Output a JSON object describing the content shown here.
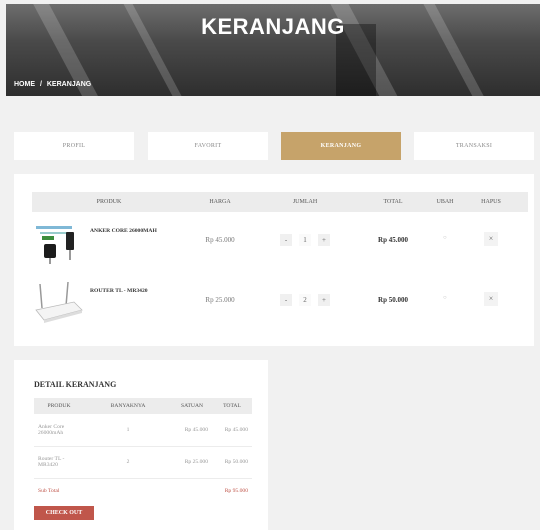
{
  "header": {
    "title": "KERANJANG",
    "breadcrumb": [
      "HOME",
      "/",
      "KERANJANG"
    ]
  },
  "tabs": [
    {
      "label": "PROFIL",
      "active": false
    },
    {
      "label": "FAVORIT",
      "active": false
    },
    {
      "label": "KERANJANG",
      "active": true
    },
    {
      "label": "TRANSAKSI",
      "active": false
    }
  ],
  "cart": {
    "columns": [
      "PRODUK",
      "HARGA",
      "JUMLAH",
      "TOTAL",
      "UBAH",
      "HAPUS"
    ],
    "items": [
      {
        "name": "ANKER CORE 26000MAH",
        "price": "Rp 45.000",
        "qty": "1",
        "total": "Rp 45.000",
        "edit_icon": "edit-icon",
        "delete_icon": "close-icon"
      },
      {
        "name": "ROUTER TL - MR3420",
        "price": "Rp 25.000",
        "qty": "2",
        "total": "Rp 50.000",
        "edit_icon": "edit-icon",
        "delete_icon": "close-icon"
      }
    ],
    "minus": "-",
    "plus": "+",
    "edit_symbol": "○",
    "delete_symbol": "×"
  },
  "detail": {
    "title": "DETAIL KERANJANG",
    "columns": [
      "PRODUK",
      "BANYAKNYA",
      "SATUAN",
      "TOTAL"
    ],
    "rows": [
      {
        "product": "Anker Core 26000mAh",
        "qty": "1",
        "unit": "Rp 45.000",
        "total": "Rp 45.000"
      },
      {
        "product": "Router TL - MR3420",
        "qty": "2",
        "unit": "Rp 25.000",
        "total": "Rp 50.000"
      }
    ],
    "subtotal_label": "Sub Total",
    "subtotal_value": "Rp 95.000",
    "checkout_label": "CHECK OUT"
  },
  "colors": {
    "accent": "#c6a36a",
    "danger": "#c0564b"
  }
}
